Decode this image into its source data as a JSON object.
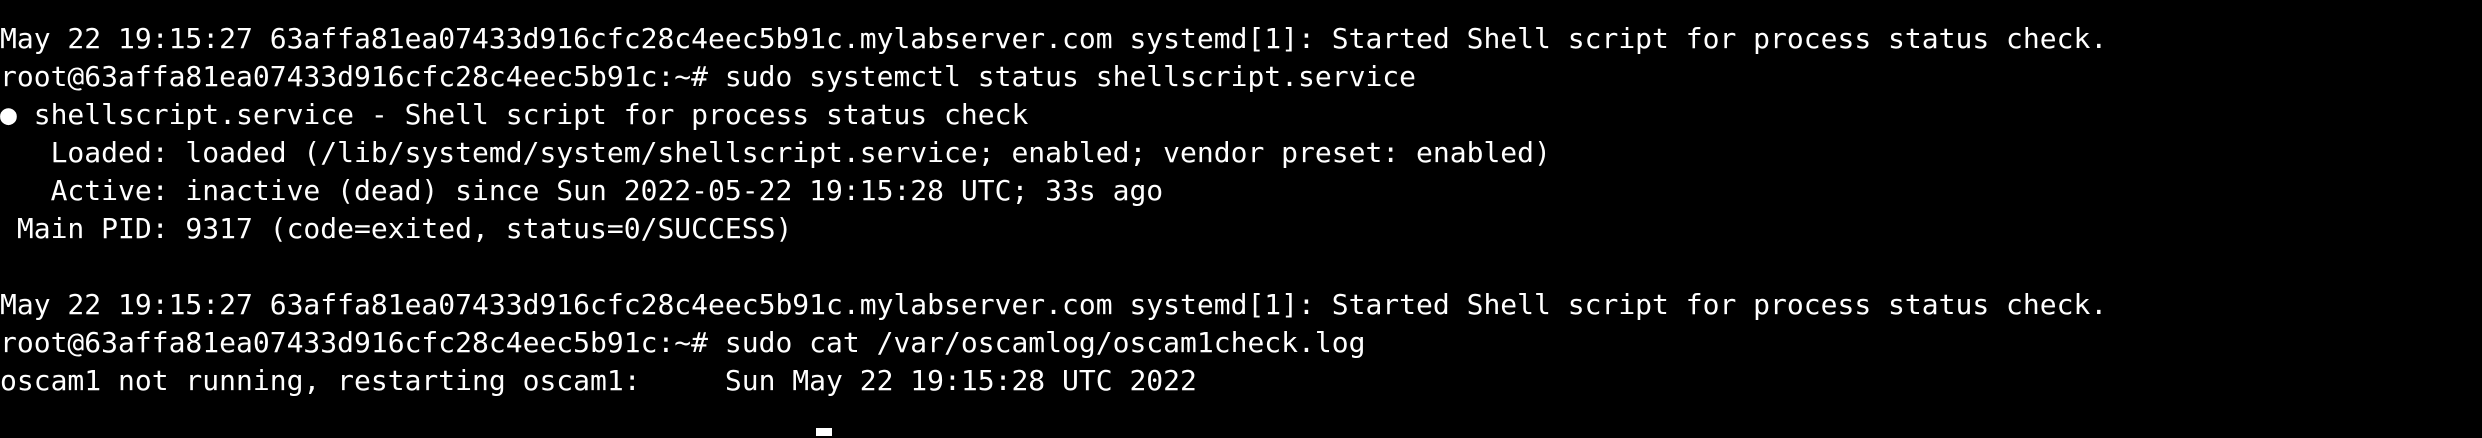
{
  "terminal": {
    "background": "#000000",
    "foreground": "#ffffff",
    "lines": [
      "May 22 19:15:27 63affa81ea07433d916cfc28c4eec5b91c.mylabserver.com systemd[1]: Started Shell script for process status check.",
      "root@63affa81ea07433d916cfc28c4eec5b91c:~# sudo systemctl status shellscript.service",
      "● shellscript.service - Shell script for process status check",
      "   Loaded: loaded (/lib/systemd/system/shellscript.service; enabled; vendor preset: enabled)",
      "   Active: inactive (dead) since Sun 2022-05-22 19:15:28 UTC; 33s ago",
      " Main PID: 9317 (code=exited, status=0/SUCCESS)",
      "",
      "May 22 19:15:27 63affa81ea07433d916cfc28c4eec5b91c.mylabserver.com systemd[1]: Started Shell script for process status check.",
      "root@63affa81ea07433d916cfc28c4eec5b91c:~# sudo cat /var/oscamlog/oscam1check.log",
      "oscam1 not running, restarting oscam1:     Sun May 22 19:15:28 UTC 2022"
    ]
  }
}
